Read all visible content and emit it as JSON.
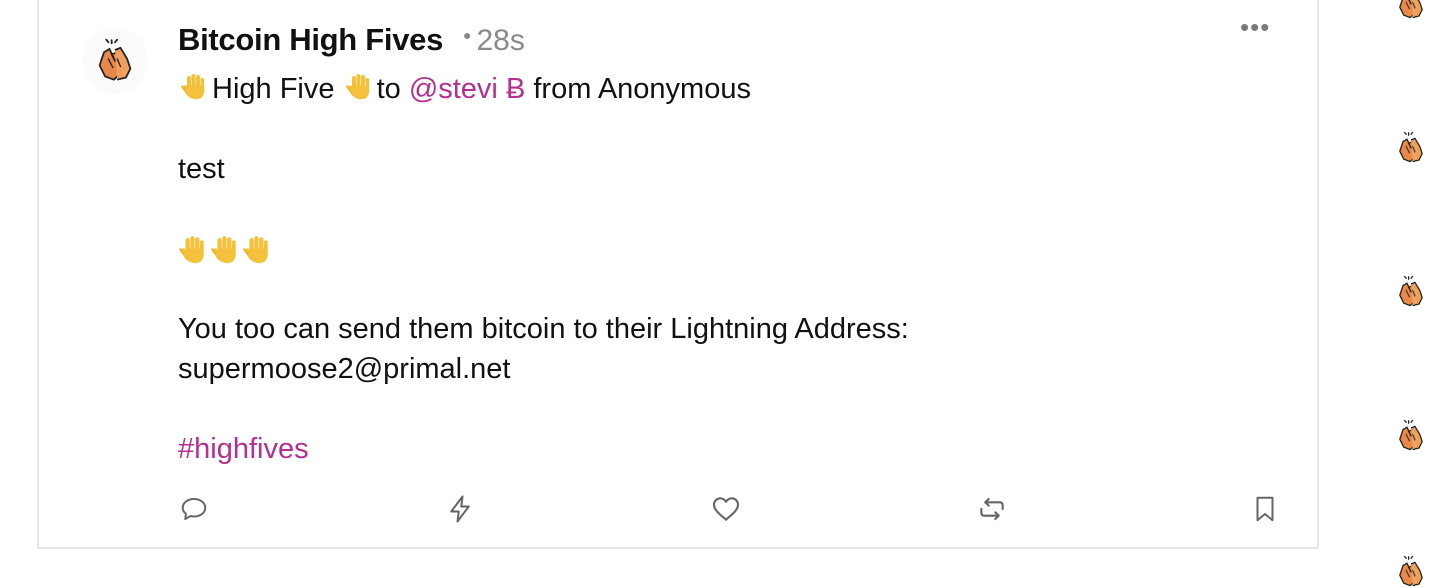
{
  "post": {
    "author": "Bitcoin High Fives",
    "time": "28s",
    "line1": {
      "high_five_text": "High Five",
      "to_text": "to",
      "mention": "@stevi",
      "bitcoin_symbol": "Ƀ",
      "from_text": "from Anonymous"
    },
    "body": "test",
    "address_line1": "You too can send them bitcoin to their Lightning Address:",
    "address_line2": "supermoose2@primal.net",
    "hashtag": "#highfives"
  },
  "icons": {
    "avatar": "high-five-emoji-icon",
    "more": "more-dots-icon",
    "reply": "reply-icon",
    "zap": "zap-icon",
    "like": "heart-icon",
    "repost": "repost-icon",
    "bookmark": "bookmark-icon"
  },
  "colors": {
    "accent": "#b52f8f",
    "muted": "#8a8a8a",
    "text": "#111111"
  }
}
